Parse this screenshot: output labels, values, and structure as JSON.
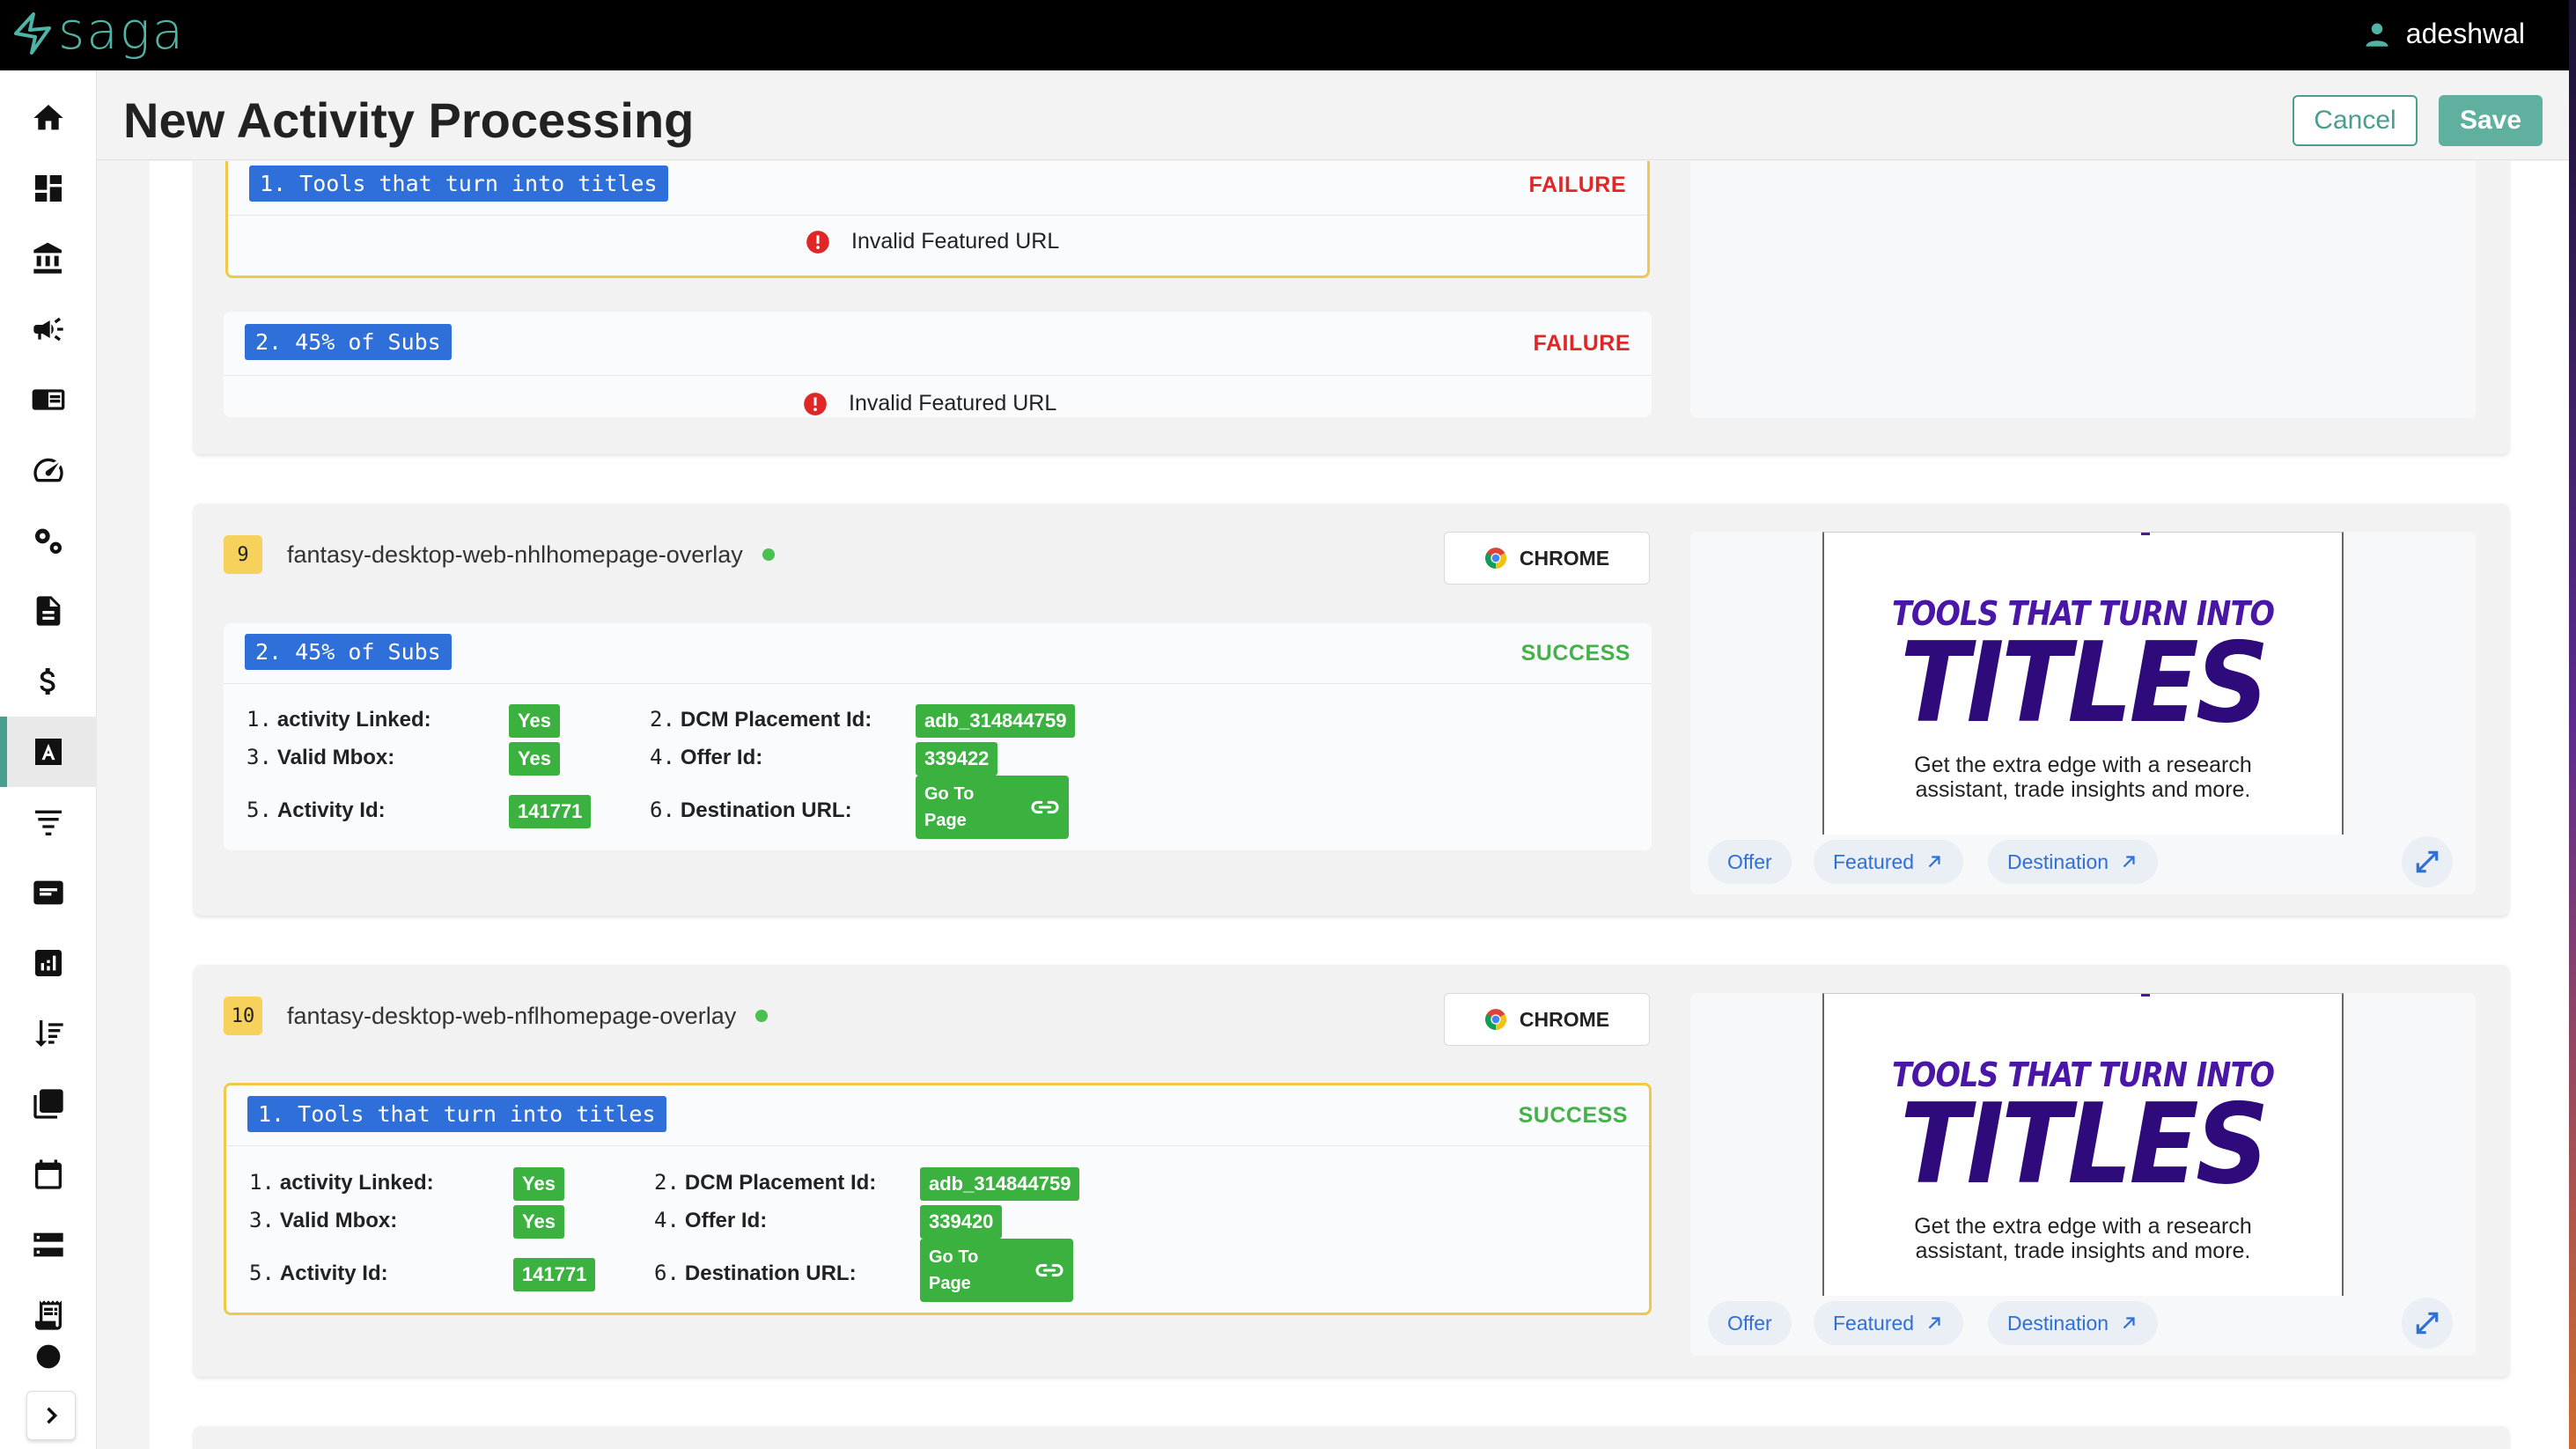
{
  "app": {
    "logo_text": "saga",
    "user_name": "adeshwal"
  },
  "header": {
    "title": "New Activity Processing",
    "cancel_label": "Cancel",
    "save_label": "Save"
  },
  "sidebar": {
    "items": [
      {
        "icon": "home-icon"
      },
      {
        "icon": "dashboard-icon"
      },
      {
        "icon": "bank-icon"
      },
      {
        "icon": "campaign-icon"
      },
      {
        "icon": "layout-icon"
      },
      {
        "icon": "speed-icon"
      },
      {
        "icon": "settings-icon"
      },
      {
        "icon": "document-icon"
      },
      {
        "icon": "dollar-icon"
      },
      {
        "icon": "text-icon",
        "active": true
      },
      {
        "icon": "filter-icon"
      },
      {
        "icon": "message-icon"
      },
      {
        "icon": "chart-icon"
      },
      {
        "icon": "sort-icon"
      },
      {
        "icon": "copy-icon"
      },
      {
        "icon": "calendar-icon"
      },
      {
        "icon": "storage-icon"
      },
      {
        "icon": "receipt-icon"
      }
    ]
  },
  "card_top": {
    "panel1": {
      "tag": "1. Tools that turn into titles",
      "status": "FAILURE",
      "message": "Invalid Featured URL"
    },
    "panel2": {
      "tag": "2. 45% of Subs",
      "status": "FAILURE",
      "message": "Invalid Featured URL"
    }
  },
  "activities": [
    {
      "number": "9",
      "name": "fantasy-desktop-web-nhlhomepage-overlay",
      "browser": "CHROME",
      "tag": "2. 45% of Subs",
      "status": "SUCCESS",
      "fields": {
        "f1_num": "1.",
        "f1_label": "activity Linked:",
        "f1_value": "Yes",
        "f2_num": "2.",
        "f2_label": "DCM Placement Id:",
        "f2_value": "adb_314844759",
        "f3_num": "3.",
        "f3_label": "Valid Mbox:",
        "f3_value": "Yes",
        "f4_num": "4.",
        "f4_label": "Offer Id:",
        "f4_value": "339422",
        "f5_num": "5.",
        "f5_label": "Activity Id:",
        "f5_value": "141771",
        "f6_num": "6.",
        "f6_label": "Destination URL:",
        "goto_line1": "Go To",
        "goto_line2": "Page"
      },
      "preview": {
        "headline1": "TOOLS THAT TURN INTO",
        "headline2": "TITLES",
        "sub1": "Get the extra edge with a research",
        "sub2": "assistant, trade insights and more.",
        "chips": [
          "Offer",
          "Featured",
          "Destination"
        ]
      }
    },
    {
      "number": "10",
      "name": "fantasy-desktop-web-nflhomepage-overlay",
      "browser": "CHROME",
      "tag": "1. Tools that turn into titles",
      "status": "SUCCESS",
      "fields": {
        "f1_num": "1.",
        "f1_label": "activity Linked:",
        "f1_value": "Yes",
        "f2_num": "2.",
        "f2_label": "DCM Placement Id:",
        "f2_value": "adb_314844759",
        "f3_num": "3.",
        "f3_label": "Valid Mbox:",
        "f3_value": "Yes",
        "f4_num": "4.",
        "f4_label": "Offer Id:",
        "f4_value": "339420",
        "f5_num": "5.",
        "f5_label": "Activity Id:",
        "f5_value": "141771",
        "f6_num": "6.",
        "f6_label": "Destination URL:",
        "goto_line1": "Go To",
        "goto_line2": "Page"
      },
      "preview": {
        "headline1": "TOOLS THAT TURN INTO",
        "headline2": "TITLES",
        "sub1": "Get the extra edge with a research",
        "sub2": "assistant, trade insights and more.",
        "chips": [
          "Offer",
          "Featured",
          "Destination"
        ]
      }
    }
  ],
  "colors": {
    "accent": "#4a9e8f",
    "success": "#3bb13f",
    "failure": "#e02626",
    "tag_blue": "#2f6fd9",
    "warn_border": "#f0c94a"
  }
}
